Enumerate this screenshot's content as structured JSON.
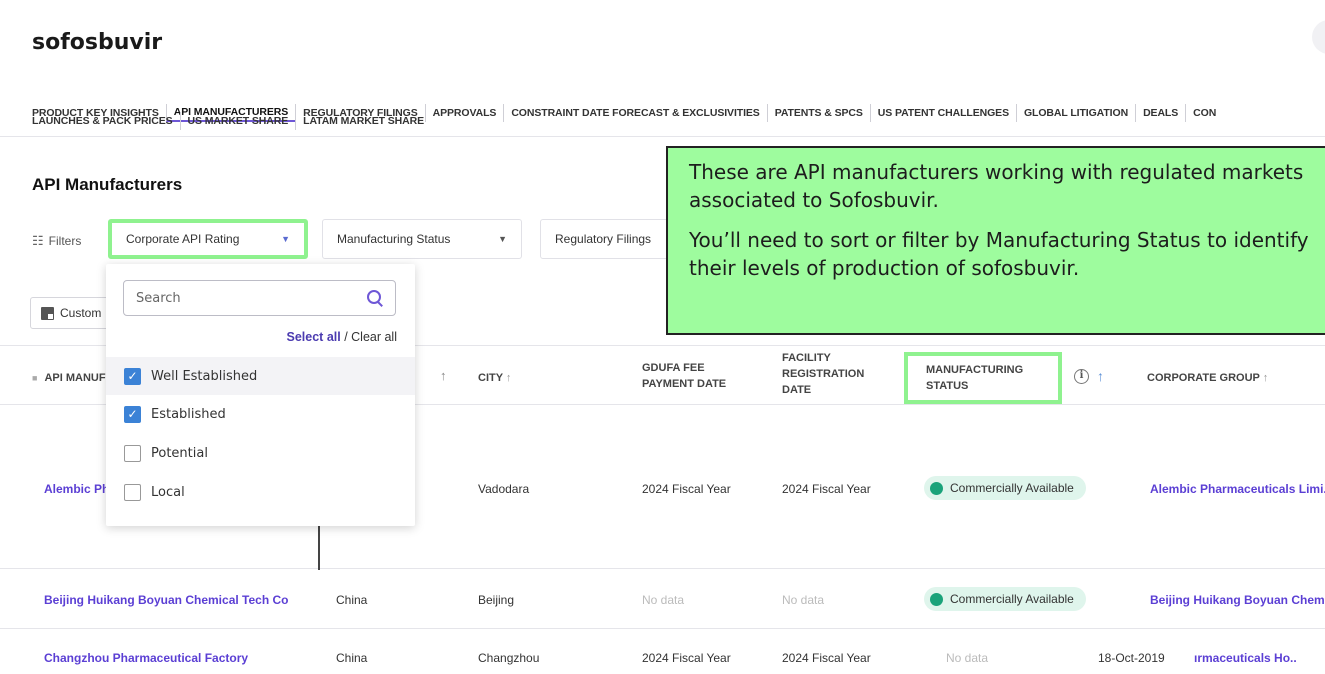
{
  "header": {
    "title": "sofosbuvir"
  },
  "nav": {
    "row1": [
      {
        "label": "PRODUCT KEY INSIGHTS",
        "active": false
      },
      {
        "label": "API MANUFACTURERS",
        "active": true
      },
      {
        "label": "REGULATORY FILINGS",
        "active": false
      },
      {
        "label": "APPROVALS",
        "active": false
      },
      {
        "label": "CONSTRAINT DATE FORECAST & EXCLUSIVITIES",
        "active": false
      },
      {
        "label": "PATENTS & SPCS",
        "active": false
      },
      {
        "label": "US PATENT CHALLENGES",
        "active": false
      },
      {
        "label": "GLOBAL LITIGATION",
        "active": false
      },
      {
        "label": "DEALS",
        "active": false
      },
      {
        "label": "CON",
        "active": false
      }
    ],
    "row2": [
      {
        "label": "LAUNCHES & PACK PRICES"
      },
      {
        "label": "US MARKET SHARE"
      },
      {
        "label": "LATAM MARKET SHARE"
      }
    ]
  },
  "section": {
    "title": "API Manufacturers"
  },
  "filters": {
    "label": "Filters",
    "corporate_api_rating": "Corporate API Rating",
    "manufacturing_status": "Manufacturing Status",
    "regulatory_filings": "Regulatory Filings"
  },
  "customize": {
    "label": "Custom"
  },
  "dropdown": {
    "search_placeholder": "Search",
    "select_all": "Select all",
    "separator": " / ",
    "clear_all": "Clear all",
    "options": [
      {
        "label": "Well Established",
        "checked": true
      },
      {
        "label": "Established",
        "checked": true
      },
      {
        "label": "Potential",
        "checked": false
      },
      {
        "label": "Local",
        "checked": false
      }
    ]
  },
  "table": {
    "headers": {
      "api_manufacturer": "API MANUF",
      "city": "CITY",
      "gdufa_line1": "GDUFA FEE",
      "gdufa_line2": "PAYMENT DATE",
      "facility_line1": "FACILITY",
      "facility_line2": "REGISTRATION",
      "facility_line3": "DATE",
      "mfg_line1": "MANUFACTURING",
      "mfg_line2": "STATUS",
      "corporate_group": "CORPORATE GROUP",
      "info": "i",
      "sort_arrow": "↑"
    },
    "rows": [
      {
        "manufacturer": "Alembic Ph",
        "country": "",
        "city": "Vadodara",
        "gdufa": "2024 Fiscal Year",
        "facility": "2024 Fiscal Year",
        "status": "Commercially Available",
        "date": "",
        "corporate": "Alembic Pharmaceuticals Limi.."
      },
      {
        "manufacturer": "Beijing Huikang Boyuan Chemical Tech Co",
        "country": "China",
        "city": "Beijing",
        "gdufa": "No data",
        "facility": "No data",
        "status": "Commercially Available",
        "date": "",
        "corporate": "Beijing Huikang Boyuan Chem.."
      },
      {
        "manufacturer": "Changzhou Pharmaceutical Factory",
        "country": "China",
        "city": "Changzhou",
        "gdufa": "2024 Fiscal Year",
        "facility": "2024 Fiscal Year",
        "status": "No data",
        "date": "18-Oct-2019",
        "corporate": "ırmaceuticals Ho.."
      }
    ]
  },
  "callout": {
    "line1": "These are API manufacturers working with regulated markets associated to Sofosbuvir.",
    "line2": "You’ll need to sort or filter by Manufacturing Status to identify their levels of production of sofosbuvir."
  },
  "colors": {
    "accent": "#6e57d6",
    "link": "#5b3fd4",
    "highlight": "#8ff28f",
    "callout_bg": "#9efc9e",
    "status_dot": "#1aa37a"
  }
}
